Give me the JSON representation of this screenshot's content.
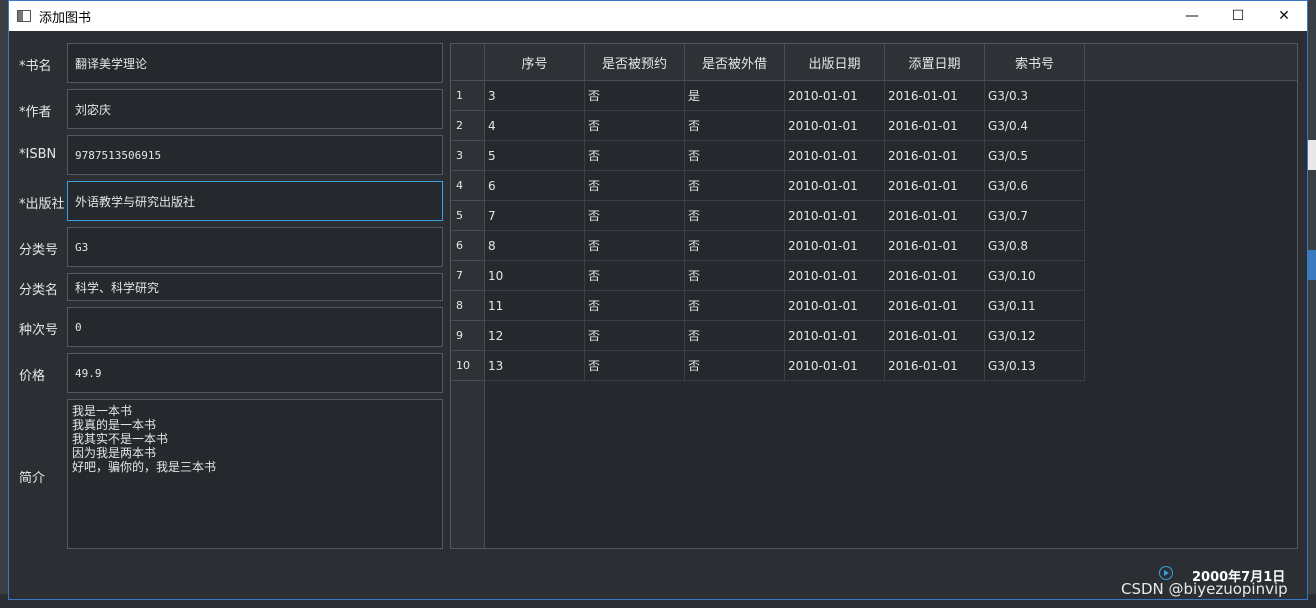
{
  "window": {
    "title": "添加图书",
    "minimize": "—",
    "maximize": "☐",
    "close": "✕"
  },
  "form": {
    "fields": [
      {
        "label": "*书名",
        "value": "翻译美学理论"
      },
      {
        "label": "*作者",
        "value": "刘宓庆"
      },
      {
        "label": "*ISBN",
        "value": "9787513506915"
      },
      {
        "label": "*出版社",
        "value": "外语教学与研究出版社"
      },
      {
        "label": "分类号",
        "value": "G3"
      },
      {
        "label": "分类名",
        "value": "科学、科学研究"
      },
      {
        "label": "种次号",
        "value": "0"
      },
      {
        "label": "价格",
        "value": "49.9"
      }
    ],
    "intro_label": "简介",
    "intro_value": "我是一本书\n我真的是一本书\n我其实不是一本书\n因为我是两本书\n好吧，骗你的，我是三本书"
  },
  "table": {
    "headers": [
      "序号",
      "是否被预约",
      "是否被外借",
      "出版日期",
      "添置日期",
      "索书号"
    ],
    "row_numbers": [
      "1",
      "2",
      "3",
      "4",
      "5",
      "6",
      "7",
      "8",
      "9",
      "10"
    ],
    "rows": [
      [
        "3",
        "否",
        "是",
        "2010-01-01",
        "2016-01-01",
        "G3/0.3"
      ],
      [
        "4",
        "否",
        "否",
        "2010-01-01",
        "2016-01-01",
        "G3/0.4"
      ],
      [
        "5",
        "否",
        "否",
        "2010-01-01",
        "2016-01-01",
        "G3/0.5"
      ],
      [
        "6",
        "否",
        "否",
        "2010-01-01",
        "2016-01-01",
        "G3/0.6"
      ],
      [
        "7",
        "否",
        "否",
        "2010-01-01",
        "2016-01-01",
        "G3/0.7"
      ],
      [
        "8",
        "否",
        "否",
        "2010-01-01",
        "2016-01-01",
        "G3/0.8"
      ],
      [
        "10",
        "否",
        "否",
        "2010-01-01",
        "2016-01-01",
        "G3/0.10"
      ],
      [
        "11",
        "否",
        "否",
        "2010-01-01",
        "2016-01-01",
        "G3/0.11"
      ],
      [
        "12",
        "否",
        "否",
        "2010-01-01",
        "2016-01-01",
        "G3/0.12"
      ],
      [
        "13",
        "否",
        "否",
        "2010-01-01",
        "2016-01-01",
        "G3/0.13"
      ]
    ]
  },
  "footer": {
    "date": "2000年7月1日",
    "watermark": "CSDN @biyezuopinvip"
  },
  "colors": {
    "accent": "#3aa0e0",
    "background": "#2b2f33",
    "field": "#25282c"
  }
}
